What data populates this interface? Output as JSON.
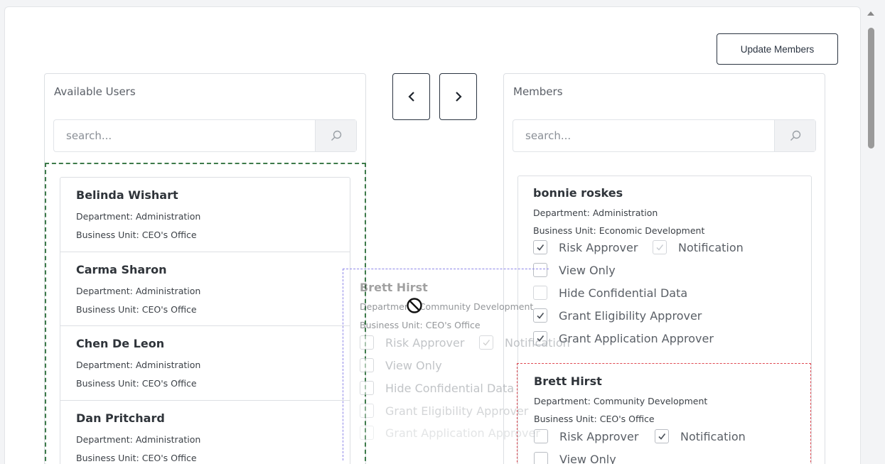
{
  "toolbar": {
    "update_label": "Update Members"
  },
  "available": {
    "title": "Available Users",
    "search_placeholder": "search...",
    "users": [
      {
        "name": "Belinda Wishart",
        "department": "Department: Administration",
        "business_unit": "Business Unit: CEO's Office"
      },
      {
        "name": "Carma Sharon",
        "department": "Department: Administration",
        "business_unit": "Business Unit: CEO's Office"
      },
      {
        "name": "Chen De Leon",
        "department": "Department: Administration",
        "business_unit": "Business Unit: CEO's Office"
      },
      {
        "name": "Dan Pritchard",
        "department": "Department: Administration",
        "business_unit": "Business Unit: CEO's Office"
      }
    ]
  },
  "transfer": {
    "move_left": "‹",
    "move_right": "›"
  },
  "members": {
    "title": "Members",
    "search_placeholder": "search...",
    "list": [
      {
        "name": "bonnie roskes",
        "department": "Department: Administration",
        "business_unit": "Business Unit: Economic Development",
        "roles": {
          "risk_approver": {
            "label": "Risk Approver",
            "checked": true
          },
          "notification": {
            "label": "Notification",
            "checked": true,
            "disabled": true
          },
          "view_only": {
            "label": "View Only",
            "checked": false
          },
          "hide_confidential": {
            "label": "Hide Confidential Data",
            "checked": false
          },
          "grant_eligibility": {
            "label": "Grant Eligibility Approver",
            "checked": true
          },
          "grant_application": {
            "label": "Grant Application Approver",
            "checked": true
          }
        }
      },
      {
        "name": "Brett Hirst",
        "department": "Department: Community Development",
        "business_unit": "Business Unit: CEO's Office",
        "roles": {
          "risk_approver": {
            "label": "Risk Approver",
            "checked": false
          },
          "notification": {
            "label": "Notification",
            "checked": true
          },
          "view_only": {
            "label": "View Only",
            "checked": false
          }
        }
      }
    ]
  },
  "drag_ghost": {
    "name": "Brett Hirst",
    "department": "Department: Community Development",
    "business_unit": "Business Unit: CEO's Office",
    "roles": [
      "Risk Approver",
      "Notification",
      "View Only",
      "Hide Confidential Data",
      "Grant Eligibility Approver",
      "Grant Application Approver"
    ]
  },
  "icons": {
    "search": "search-icon",
    "not_allowed": "not-allowed-cursor-icon"
  },
  "colors": {
    "drop_zone": "#3d7a4a",
    "drop_target": "#e04a52",
    "drag_preview": "#8d86e8",
    "button_border": "#2b3441"
  }
}
